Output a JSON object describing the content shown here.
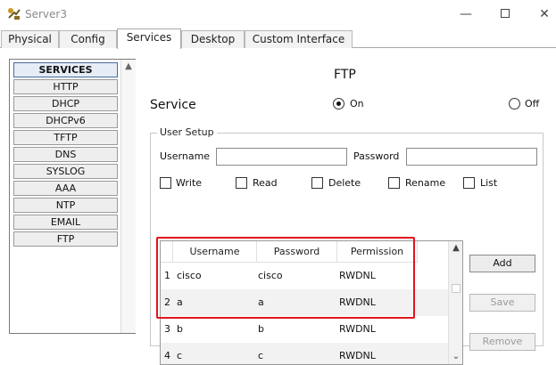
{
  "window": {
    "title": "Server3",
    "controls": {
      "minimize": "—",
      "close": "✕"
    }
  },
  "tabs": [
    {
      "label": "Physical",
      "active": false
    },
    {
      "label": "Config",
      "active": false
    },
    {
      "label": "Services",
      "active": true
    },
    {
      "label": "Desktop",
      "active": false
    },
    {
      "label": "Custom Interface",
      "active": false
    }
  ],
  "sidebar": {
    "items": [
      {
        "label": "SERVICES",
        "active": true
      },
      {
        "label": "HTTP"
      },
      {
        "label": "DHCP"
      },
      {
        "label": "DHCPv6"
      },
      {
        "label": "TFTP"
      },
      {
        "label": "DNS"
      },
      {
        "label": "SYSLOG"
      },
      {
        "label": "AAA"
      },
      {
        "label": "NTP"
      },
      {
        "label": "EMAIL"
      },
      {
        "label": "FTP"
      }
    ]
  },
  "ftp": {
    "title": "FTP",
    "service_label": "Service",
    "radio_on_label": "On",
    "radio_off_label": "Off",
    "service_state": "On",
    "user_setup": {
      "legend": "User Setup",
      "username_label": "Username",
      "password_label": "Password",
      "username_value": "",
      "password_value": "",
      "permissions": [
        {
          "label": "Write",
          "checked": false
        },
        {
          "label": "Read",
          "checked": false
        },
        {
          "label": "Delete",
          "checked": false
        },
        {
          "label": "Rename",
          "checked": false
        },
        {
          "label": "List",
          "checked": false
        }
      ],
      "table": {
        "columns": [
          "Username",
          "Password",
          "Permission"
        ],
        "rows": [
          {
            "index": "1",
            "username": "cisco",
            "password": "cisco",
            "permission": "RWDNL"
          },
          {
            "index": "2",
            "username": "a",
            "password": "a",
            "permission": "RWDNL"
          },
          {
            "index": "3",
            "username": "b",
            "password": "b",
            "permission": "RWDNL"
          },
          {
            "index": "4",
            "username": "c",
            "password": "c",
            "permission": "RWDNL"
          }
        ]
      },
      "buttons": {
        "add": "Add",
        "save": "Save",
        "remove": "Remove"
      }
    }
  },
  "colors": {
    "highlight": "#e0141e",
    "active_border": "#4a6aa0"
  },
  "icons": {
    "app": "server-app-icon",
    "scroll_up": "▲",
    "scroll_down": "⌄"
  }
}
